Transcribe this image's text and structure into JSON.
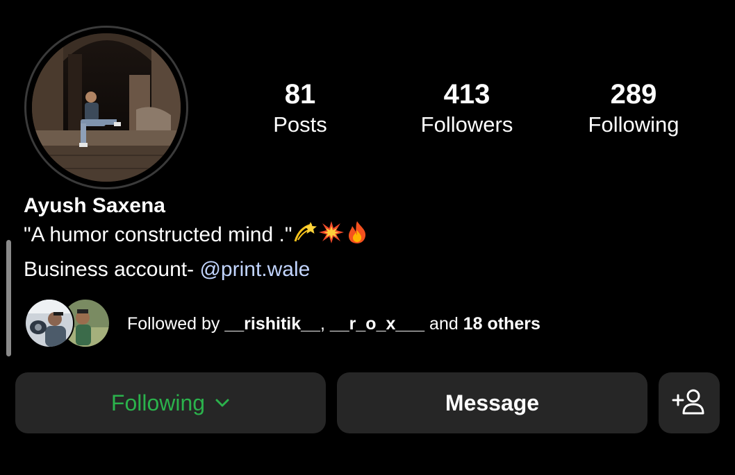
{
  "profile": {
    "display_name": "Ayush Saxena",
    "bio_quote": "\"A humor constructed mind .\"",
    "bio_emojis": [
      "dizzy-emoji",
      "collision-emoji",
      "fire-emoji"
    ],
    "business_prefix": "Business account- ",
    "business_handle": "@print.wale"
  },
  "stats": {
    "posts": {
      "count": "81",
      "label": "Posts"
    },
    "followers": {
      "count": "413",
      "label": "Followers"
    },
    "following": {
      "count": "289",
      "label": "Following"
    }
  },
  "mutuals": {
    "prefix": "Followed by ",
    "user1": "__rishitik__",
    "separator": ", ",
    "user2": "__r_o_x___",
    "conjunction": " and ",
    "others": "18 others"
  },
  "actions": {
    "following_label": "Following",
    "message_label": "Message",
    "add_user_icon": "add-user-icon"
  },
  "colors": {
    "background": "#000000",
    "button_bg": "#262626",
    "following_green": "#2bb24c",
    "mention_blue": "#c2d5ff"
  }
}
